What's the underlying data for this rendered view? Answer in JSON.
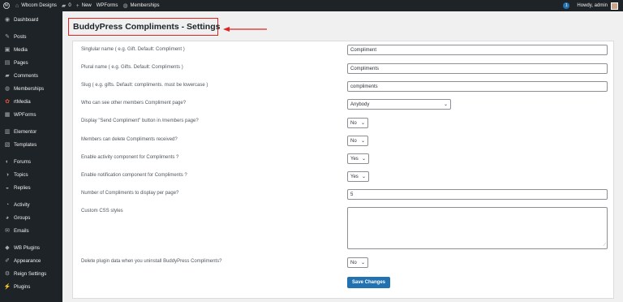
{
  "adminbar": {
    "site_name": "Wbcom Designs",
    "comments_count": "0",
    "new_label": "New",
    "wpforms_label": "WPForms",
    "memberships_label": "Memberships",
    "notification_count": "1",
    "greeting": "Howdy, admin"
  },
  "sidebar": {
    "items": [
      {
        "label": "Dashboard",
        "icon": "dashboard-icon",
        "glyph": "◉"
      },
      {
        "label": "Posts",
        "icon": "pin-icon",
        "glyph": "✎"
      },
      {
        "label": "Media",
        "icon": "media-icon",
        "glyph": "▣"
      },
      {
        "label": "Pages",
        "icon": "pages-icon",
        "glyph": "▤"
      },
      {
        "label": "Comments",
        "icon": "comments-icon",
        "glyph": "▰"
      },
      {
        "label": "Memberships",
        "icon": "memberships-icon",
        "glyph": "◍"
      },
      {
        "label": "rtMedia",
        "icon": "rtmedia-icon",
        "glyph": "✿"
      },
      {
        "label": "WPForms",
        "icon": "wpforms-icon",
        "glyph": "▦"
      },
      {
        "label": "Elementor",
        "icon": "elementor-icon",
        "glyph": "▥"
      },
      {
        "label": "Templates",
        "icon": "templates-icon",
        "glyph": "▧"
      },
      {
        "label": "Forums",
        "icon": "forums-icon",
        "glyph": "◐"
      },
      {
        "label": "Topics",
        "icon": "topics-icon",
        "glyph": "◑"
      },
      {
        "label": "Replies",
        "icon": "replies-icon",
        "glyph": "◒"
      },
      {
        "label": "Activity",
        "icon": "activity-icon",
        "glyph": "◔"
      },
      {
        "label": "Groups",
        "icon": "groups-icon",
        "glyph": "◕"
      },
      {
        "label": "Emails",
        "icon": "emails-icon",
        "glyph": "✉"
      },
      {
        "label": "WB Plugins",
        "icon": "wb-plugins-icon",
        "glyph": "◆"
      },
      {
        "label": "Appearance",
        "icon": "appearance-icon",
        "glyph": "✐"
      },
      {
        "label": "Reign Settings",
        "icon": "reign-settings-icon",
        "glyph": "⚙"
      },
      {
        "label": "Plugins",
        "icon": "plugins-icon",
        "glyph": "⚡"
      }
    ]
  },
  "page": {
    "title": "BuddyPress Compliments - Settings"
  },
  "settings": {
    "singular_label": "Singlular name ( e.g. Gift. Default: Compliment )",
    "singular_value": "Compliment",
    "plural_label": "Plural name ( e.g. Gifts. Default: Compliments )",
    "plural_value": "Compliments",
    "slug_label": "Slug ( e.g. gifts. Default: compliments. must be lowercase )",
    "slug_value": "compliments",
    "who_can_see_label": "Who can see other members Compliment page?",
    "who_can_see_value": "Anybody",
    "display_button_label": "Display \"Send Compliment\" button in /members page?",
    "display_button_value": "No",
    "members_delete_label": "Members can delete Compliments received?",
    "members_delete_value": "No",
    "activity_label": "Enable activity component for Compliments ?",
    "activity_value": "Yes",
    "notification_label": "Enable notification component for Compliments ?",
    "notification_value": "Yes",
    "per_page_label": "Number of Compliments to display per page?",
    "per_page_value": "5",
    "css_label": "Custom CSS styles",
    "css_value": "",
    "delete_data_label": "Delete plugin data when you uninstall BuddyPress Compliments?",
    "delete_data_value": "No",
    "save_label": "Save Changes"
  },
  "colors": {
    "annotation_red": "#e02424",
    "primary_blue": "#2271b1",
    "sidebar_bg": "#1d2327"
  }
}
